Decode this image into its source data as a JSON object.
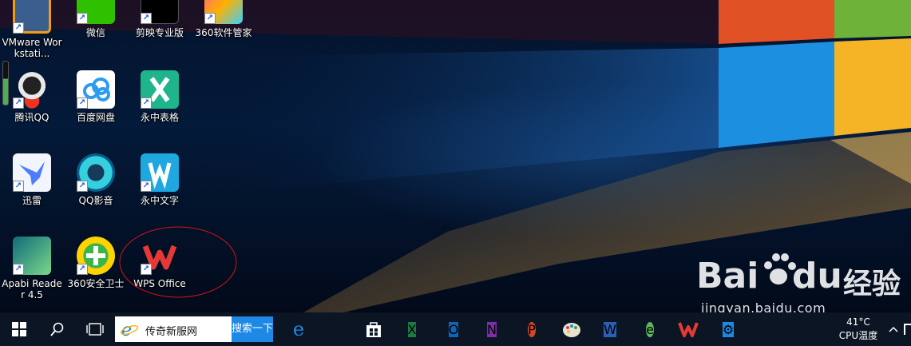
{
  "desktop_icons": [
    {
      "label": "VMware Workstati...",
      "icon": "vmware-icon"
    },
    {
      "label": "微信",
      "icon": "wechat-icon"
    },
    {
      "label": "剪映专业版",
      "icon": "capcut-icon"
    },
    {
      "label": "360软件管家",
      "icon": "360-software-manager-icon"
    },
    {
      "label": "腾讯QQ",
      "icon": "qq-penguin-icon"
    },
    {
      "label": "百度网盘",
      "icon": "baidu-netdisk-icon"
    },
    {
      "label": "永中表格",
      "icon": "yozo-sheet-icon"
    },
    {
      "label": "迅雷",
      "icon": "xunlei-icon"
    },
    {
      "label": "QQ影音",
      "icon": "qq-player-icon"
    },
    {
      "label": "永中文字",
      "icon": "yozo-writer-icon"
    },
    {
      "label": "Apabi Reader 4.5",
      "icon": "apabi-reader-icon"
    },
    {
      "label": "360安全卫士",
      "icon": "360-safe-icon"
    },
    {
      "label": "WPS Office",
      "icon": "wps-office-icon"
    }
  ],
  "shortcut_glyph": "↗",
  "watermark": {
    "brand_left": "Bai",
    "brand_right": "du",
    "suffix": "经验",
    "url": "jingyan.baidu.com"
  },
  "taskbar": {
    "search_text": "传奇新服网",
    "search_button": "搜索一下",
    "apps": [
      {
        "icon": "edge-icon",
        "glyph": "e",
        "color": "#1e88e5"
      },
      {
        "icon": "file-explorer-icon",
        "glyph": "",
        "color": "#f6c343"
      },
      {
        "icon": "store-icon",
        "glyph": "",
        "color": "#ffffff"
      },
      {
        "icon": "excel-icon",
        "glyph": "X",
        "color": "#1d7a45"
      },
      {
        "icon": "outlook-icon",
        "glyph": "O",
        "color": "#0f64b5"
      },
      {
        "icon": "onenote-icon",
        "glyph": "N",
        "color": "#7b2fa8"
      },
      {
        "icon": "powerpoint-icon",
        "glyph": "P",
        "color": "#d24726"
      },
      {
        "icon": "paint-icon",
        "glyph": "",
        "color": "#ffffff"
      },
      {
        "icon": "word-icon",
        "glyph": "W",
        "color": "#2b5fb4"
      },
      {
        "icon": "browser-icon",
        "glyph": "e",
        "color": "#5cb85c"
      },
      {
        "icon": "wps-icon",
        "glyph": "W",
        "color": "#e53935"
      },
      {
        "icon": "settings-icon",
        "glyph": "⚙",
        "color": "#1e88e5"
      }
    ],
    "tray": {
      "temp": "41°C",
      "temp_label": "CPU温度",
      "chevron": "^"
    }
  }
}
